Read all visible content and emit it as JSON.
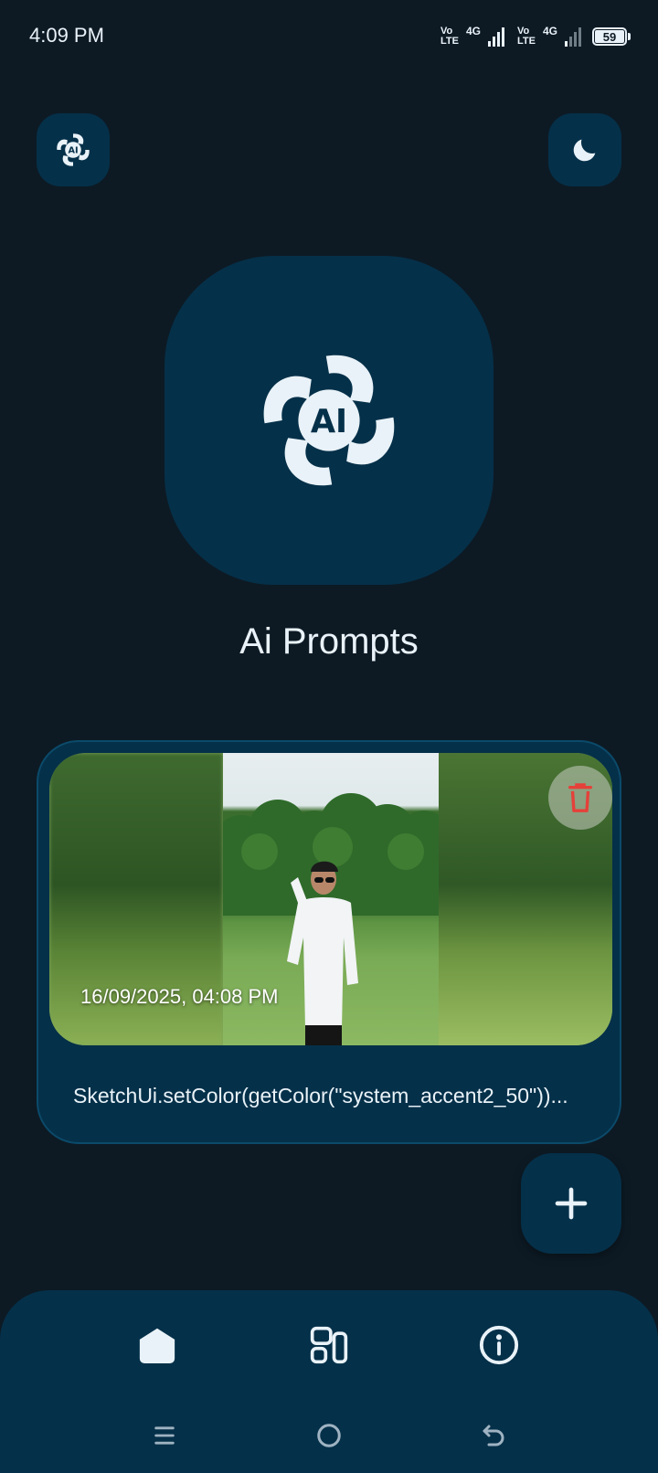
{
  "status_bar": {
    "time": "4:09 PM",
    "sim1": {
      "volte_top": "Vo",
      "volte_bottom": "LTE",
      "network": "4G"
    },
    "sim2": {
      "volte_top": "Vo",
      "volte_bottom": "LTE",
      "network": "4G"
    },
    "battery": "59"
  },
  "header": {
    "logo_icon": "ai-logo-icon",
    "theme_icon": "moon-icon"
  },
  "hero": {
    "logo_text": "AI",
    "app_title": "Ai Prompts"
  },
  "prompt_card": {
    "timestamp": "16/09/2025, 04:08 PM",
    "prompt_text": "SketchUi.setColor(getColor(\"system_accent2_50\"))...",
    "delete_icon": "trash-icon"
  },
  "fab": {
    "icon": "plus-icon"
  },
  "bottom_nav": {
    "items": [
      {
        "icon": "home-icon",
        "active": true
      },
      {
        "icon": "widgets-icon",
        "active": false
      },
      {
        "icon": "info-icon",
        "active": false
      }
    ]
  },
  "system_nav": {
    "items": [
      "menu-icon",
      "circle-home-icon",
      "back-icon"
    ]
  },
  "colors": {
    "background": "#0d1a24",
    "surface": "#053049",
    "on_surface": "#e9f2f8",
    "delete_red": "#e5413a"
  }
}
